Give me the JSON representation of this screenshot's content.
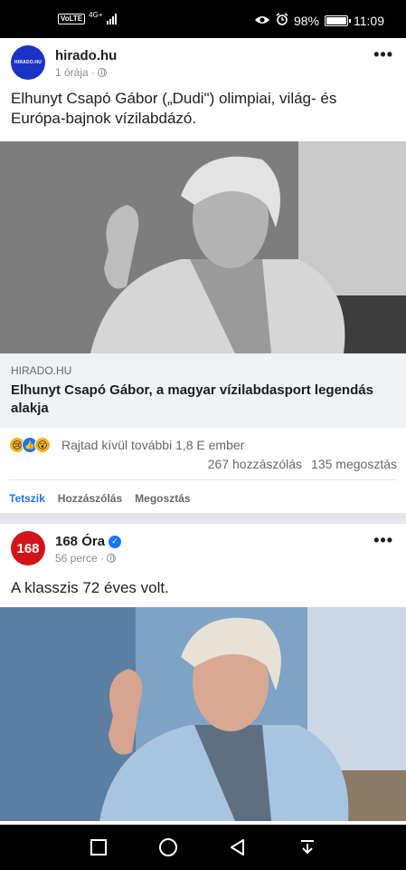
{
  "status_bar": {
    "volte": "VoLTE",
    "network": "4G+",
    "battery": "98%",
    "battery_level": 0.98,
    "time": "11:09"
  },
  "posts": [
    {
      "author": "hirado.hu",
      "avatar_text": "HIRADO.HU",
      "time": "1 órája",
      "text": "Elhunyt Csapó Gábor („Dudi\") olimpiai, világ- és Európa-bajnok vízilabdázó.",
      "link": {
        "domain": "HIRADO.HU",
        "title": "Elhunyt Csapó Gábor, a magyar vízilabdasport legendás alakja"
      },
      "reactions_text": "Rajtad kívül további 1,8 E ember",
      "comments": "267 hozzászólás",
      "shares": "135 megosztás",
      "actions": [
        "Tetszik",
        "Hozzászólás",
        "Megosztás"
      ]
    },
    {
      "author": "168 Óra",
      "avatar_text": "168",
      "time": "56 perce",
      "text": "A klasszis 72 éves volt."
    }
  ],
  "icons": {
    "eye": "eye-icon",
    "alarm": "alarm-icon",
    "globe": "globe-icon",
    "more": "more-options-icon",
    "verified": "verified-badge-icon",
    "nav_square": "recent-apps-icon",
    "nav_circle": "home-icon",
    "nav_triangle": "back-icon",
    "nav_down": "notification-pull-icon"
  },
  "colors": {
    "accent": "#1877f2",
    "hirado_brand": "#1b33c4",
    "ora_brand": "#d4141b"
  }
}
